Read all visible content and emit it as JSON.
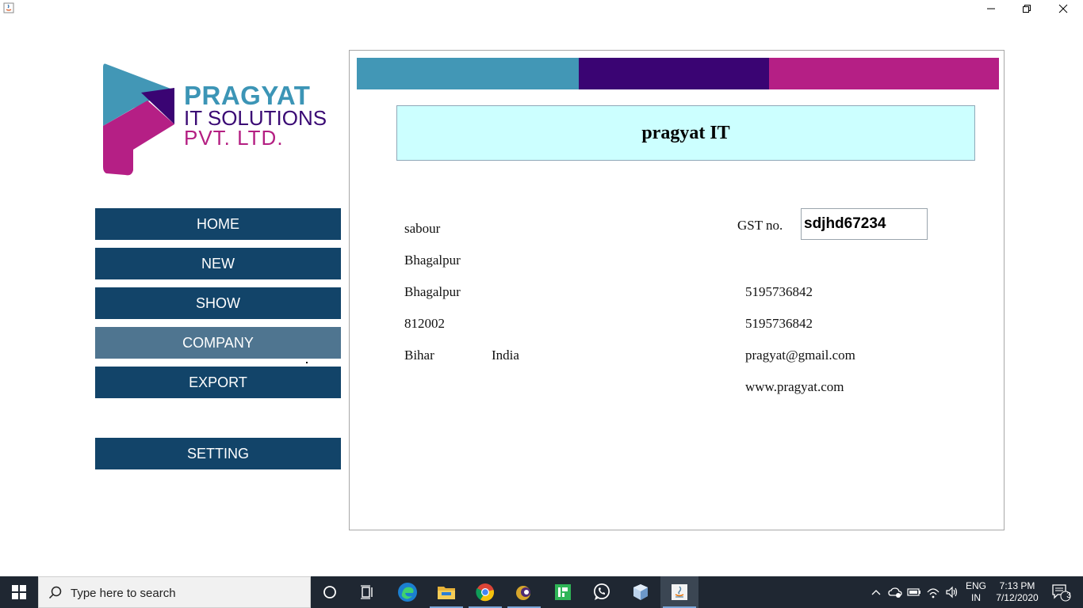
{
  "colors": {
    "nav_bg": "#124469",
    "nav_active_bg": "#4f7590",
    "bar_teal": "#4297b6",
    "bar_purple": "#3a0473",
    "bar_magenta": "#b51f85",
    "title_bg": "#ccffff",
    "taskbar_bg": "#1f2732"
  },
  "logo": {
    "line1": "PRAGYAT",
    "line2": "IT SOLUTIONS",
    "line3": "PVT. LTD."
  },
  "nav": {
    "home": "HOME",
    "new": "NEW",
    "show": "SHOW",
    "company": "COMPANY",
    "export": "EXPORT",
    "setting": "SETTING",
    "active": "COMPANY"
  },
  "company": {
    "name": "pragyat IT",
    "address1": "sabour",
    "address2": "Bhagalpur",
    "city": "Bhagalpur",
    "pin": "812002",
    "state": "Bihar",
    "country": "India",
    "gst_label": "GST no.",
    "gst_value": "sdjhd67234",
    "phone1": "5195736842",
    "phone2": "5195736842",
    "email": "pragyat@gmail.com",
    "website": "www.pragyat.com"
  },
  "taskbar": {
    "search_placeholder": "Type here to search",
    "language": "ENG",
    "region": "IN",
    "time": "7:13 PM",
    "date": "7/12/2020",
    "notification_count": "3",
    "apps": [
      "cortana-icon",
      "task-view-icon",
      "edge-icon",
      "file-explorer-icon",
      "chrome-icon",
      "eclipse-icon",
      "intellij-icon",
      "whatsapp-icon",
      "virtualbox-icon",
      "java-icon"
    ]
  }
}
